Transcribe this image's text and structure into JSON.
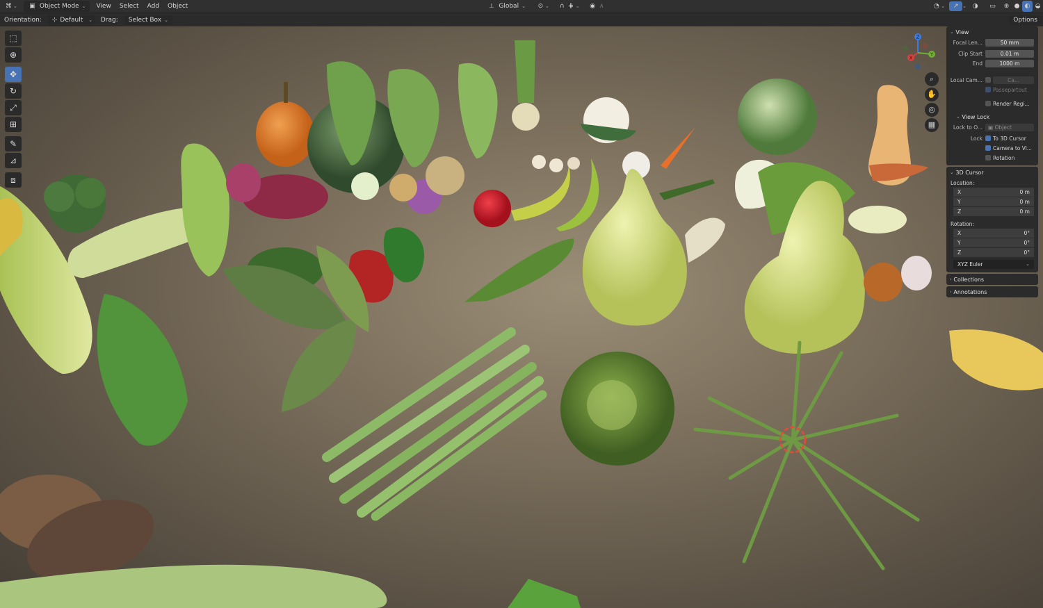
{
  "topbar": {
    "mode": "Object Mode",
    "menus": [
      "View",
      "Select",
      "Add",
      "Object"
    ],
    "transform": "Global"
  },
  "header2": {
    "orientation_label": "Orientation:",
    "orientation_value": "Default",
    "drag_label": "Drag:",
    "drag_value": "Select Box",
    "options": "Options"
  },
  "npanel": {
    "view": {
      "title": "View",
      "focal_label": "Focal Len...",
      "focal_value": "50 mm",
      "clip_start_label": "Clip Start",
      "clip_start_value": "0.01 m",
      "end_label": "End",
      "end_value": "1000 m",
      "local_cam_label": "Local Cam...",
      "local_cam_value": "Ca...",
      "passepartout": "Passepartout",
      "render_region": "Render Regi...",
      "view_lock_title": "View Lock",
      "lock_to_label": "Lock to O...",
      "lock_to_value": "Object",
      "lock_label": "Lock",
      "to_3d_cursor": "To 3D Cursor",
      "camera_to_view": "Camera to Vi...",
      "rotation": "Rotation"
    },
    "cursor": {
      "title": "3D Cursor",
      "location_label": "Location:",
      "loc": [
        {
          "axis": "X",
          "value": "0 m"
        },
        {
          "axis": "Y",
          "value": "0 m"
        },
        {
          "axis": "Z",
          "value": "0 m"
        }
      ],
      "rotation_label": "Rotation:",
      "rot": [
        {
          "axis": "X",
          "value": "0°"
        },
        {
          "axis": "Y",
          "value": "0°"
        },
        {
          "axis": "Z",
          "value": "0°"
        }
      ],
      "rotation_mode": "XYZ Euler"
    },
    "collections": "Collections",
    "annotations": "Annotations"
  },
  "gizmo": {
    "x": "X",
    "y": "Y",
    "z": "Z"
  },
  "colors": {
    "accent": "#4772b3",
    "header": "#303030",
    "panel": "#2b2b2b",
    "field": "#545454"
  }
}
